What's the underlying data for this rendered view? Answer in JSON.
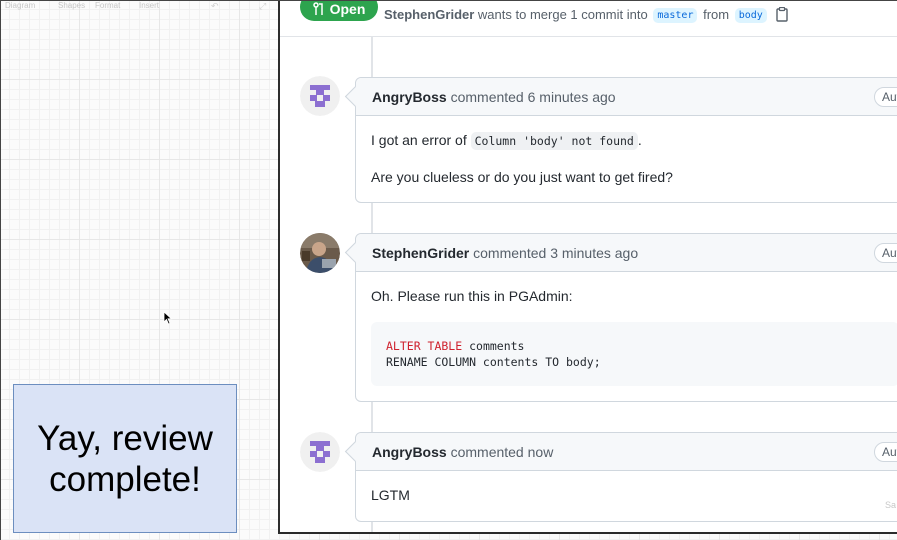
{
  "canvas": {
    "menu": [
      "Diagram",
      "Shapes",
      "Format",
      "Insert"
    ],
    "note_text": "Yay, review complete!"
  },
  "pr": {
    "state": "Open",
    "author": "StephenGrider",
    "merge_text": "wants to merge 1 commit into",
    "base_branch": "master",
    "from_text": "from",
    "head_branch": "body"
  },
  "comments": [
    {
      "author": "AngryBoss",
      "action": "commented",
      "time": "6 minutes ago",
      "badge": "Author",
      "body_prefix": "I got an error of",
      "code": "Column 'body' not found",
      "body_suffix": ".",
      "body_second": "Are you clueless or do you just want to get fired?"
    },
    {
      "author": "StephenGrider",
      "action": "commented",
      "time": "3 minutes ago",
      "badge": "Author",
      "body": "Oh. Please run this in PGAdmin:",
      "code_kw1": "ALTER TABLE",
      "code_rest1": " comments",
      "code_line2": "RENAME COLUMN contents TO body;"
    },
    {
      "author": "AngryBoss",
      "action": "commented",
      "time": "now",
      "badge": "Author",
      "body": "LGTM"
    }
  ],
  "colors": {
    "open_badge": "#2da44e",
    "note_fill": "#dae3f6",
    "note_border": "#6c8ebf",
    "avatar_identicon": "#8c6fd1"
  },
  "icons": [
    "git-pull-request-icon",
    "copy-clipboard-icon",
    "identicon-avatar",
    "photo-avatar",
    "mouse-pointer-icon"
  ],
  "watermark": "Sa"
}
